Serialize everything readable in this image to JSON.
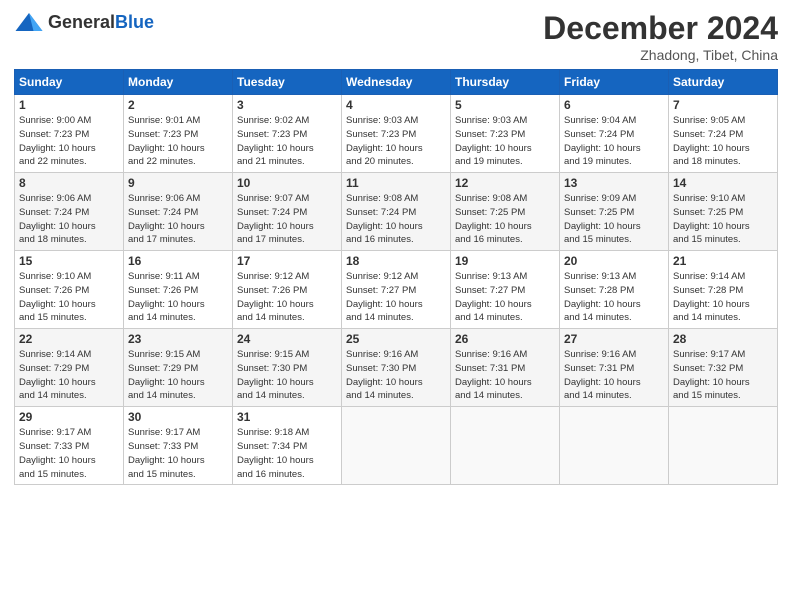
{
  "logo": {
    "general": "General",
    "blue": "Blue"
  },
  "title": {
    "month_year": "December 2024",
    "location": "Zhadong, Tibet, China"
  },
  "weekdays": [
    "Sunday",
    "Monday",
    "Tuesday",
    "Wednesday",
    "Thursday",
    "Friday",
    "Saturday"
  ],
  "weeks": [
    [
      {
        "day": "1",
        "info": "Sunrise: 9:00 AM\nSunset: 7:23 PM\nDaylight: 10 hours\nand 22 minutes."
      },
      {
        "day": "2",
        "info": "Sunrise: 9:01 AM\nSunset: 7:23 PM\nDaylight: 10 hours\nand 22 minutes."
      },
      {
        "day": "3",
        "info": "Sunrise: 9:02 AM\nSunset: 7:23 PM\nDaylight: 10 hours\nand 21 minutes."
      },
      {
        "day": "4",
        "info": "Sunrise: 9:03 AM\nSunset: 7:23 PM\nDaylight: 10 hours\nand 20 minutes."
      },
      {
        "day": "5",
        "info": "Sunrise: 9:03 AM\nSunset: 7:23 PM\nDaylight: 10 hours\nand 19 minutes."
      },
      {
        "day": "6",
        "info": "Sunrise: 9:04 AM\nSunset: 7:24 PM\nDaylight: 10 hours\nand 19 minutes."
      },
      {
        "day": "7",
        "info": "Sunrise: 9:05 AM\nSunset: 7:24 PM\nDaylight: 10 hours\nand 18 minutes."
      }
    ],
    [
      {
        "day": "8",
        "info": "Sunrise: 9:06 AM\nSunset: 7:24 PM\nDaylight: 10 hours\nand 18 minutes."
      },
      {
        "day": "9",
        "info": "Sunrise: 9:06 AM\nSunset: 7:24 PM\nDaylight: 10 hours\nand 17 minutes."
      },
      {
        "day": "10",
        "info": "Sunrise: 9:07 AM\nSunset: 7:24 PM\nDaylight: 10 hours\nand 17 minutes."
      },
      {
        "day": "11",
        "info": "Sunrise: 9:08 AM\nSunset: 7:24 PM\nDaylight: 10 hours\nand 16 minutes."
      },
      {
        "day": "12",
        "info": "Sunrise: 9:08 AM\nSunset: 7:25 PM\nDaylight: 10 hours\nand 16 minutes."
      },
      {
        "day": "13",
        "info": "Sunrise: 9:09 AM\nSunset: 7:25 PM\nDaylight: 10 hours\nand 15 minutes."
      },
      {
        "day": "14",
        "info": "Sunrise: 9:10 AM\nSunset: 7:25 PM\nDaylight: 10 hours\nand 15 minutes."
      }
    ],
    [
      {
        "day": "15",
        "info": "Sunrise: 9:10 AM\nSunset: 7:26 PM\nDaylight: 10 hours\nand 15 minutes."
      },
      {
        "day": "16",
        "info": "Sunrise: 9:11 AM\nSunset: 7:26 PM\nDaylight: 10 hours\nand 14 minutes."
      },
      {
        "day": "17",
        "info": "Sunrise: 9:12 AM\nSunset: 7:26 PM\nDaylight: 10 hours\nand 14 minutes."
      },
      {
        "day": "18",
        "info": "Sunrise: 9:12 AM\nSunset: 7:27 PM\nDaylight: 10 hours\nand 14 minutes."
      },
      {
        "day": "19",
        "info": "Sunrise: 9:13 AM\nSunset: 7:27 PM\nDaylight: 10 hours\nand 14 minutes."
      },
      {
        "day": "20",
        "info": "Sunrise: 9:13 AM\nSunset: 7:28 PM\nDaylight: 10 hours\nand 14 minutes."
      },
      {
        "day": "21",
        "info": "Sunrise: 9:14 AM\nSunset: 7:28 PM\nDaylight: 10 hours\nand 14 minutes."
      }
    ],
    [
      {
        "day": "22",
        "info": "Sunrise: 9:14 AM\nSunset: 7:29 PM\nDaylight: 10 hours\nand 14 minutes."
      },
      {
        "day": "23",
        "info": "Sunrise: 9:15 AM\nSunset: 7:29 PM\nDaylight: 10 hours\nand 14 minutes."
      },
      {
        "day": "24",
        "info": "Sunrise: 9:15 AM\nSunset: 7:30 PM\nDaylight: 10 hours\nand 14 minutes."
      },
      {
        "day": "25",
        "info": "Sunrise: 9:16 AM\nSunset: 7:30 PM\nDaylight: 10 hours\nand 14 minutes."
      },
      {
        "day": "26",
        "info": "Sunrise: 9:16 AM\nSunset: 7:31 PM\nDaylight: 10 hours\nand 14 minutes."
      },
      {
        "day": "27",
        "info": "Sunrise: 9:16 AM\nSunset: 7:31 PM\nDaylight: 10 hours\nand 14 minutes."
      },
      {
        "day": "28",
        "info": "Sunrise: 9:17 AM\nSunset: 7:32 PM\nDaylight: 10 hours\nand 15 minutes."
      }
    ],
    [
      {
        "day": "29",
        "info": "Sunrise: 9:17 AM\nSunset: 7:33 PM\nDaylight: 10 hours\nand 15 minutes."
      },
      {
        "day": "30",
        "info": "Sunrise: 9:17 AM\nSunset: 7:33 PM\nDaylight: 10 hours\nand 15 minutes."
      },
      {
        "day": "31",
        "info": "Sunrise: 9:18 AM\nSunset: 7:34 PM\nDaylight: 10 hours\nand 16 minutes."
      },
      {
        "day": "",
        "info": ""
      },
      {
        "day": "",
        "info": ""
      },
      {
        "day": "",
        "info": ""
      },
      {
        "day": "",
        "info": ""
      }
    ]
  ]
}
